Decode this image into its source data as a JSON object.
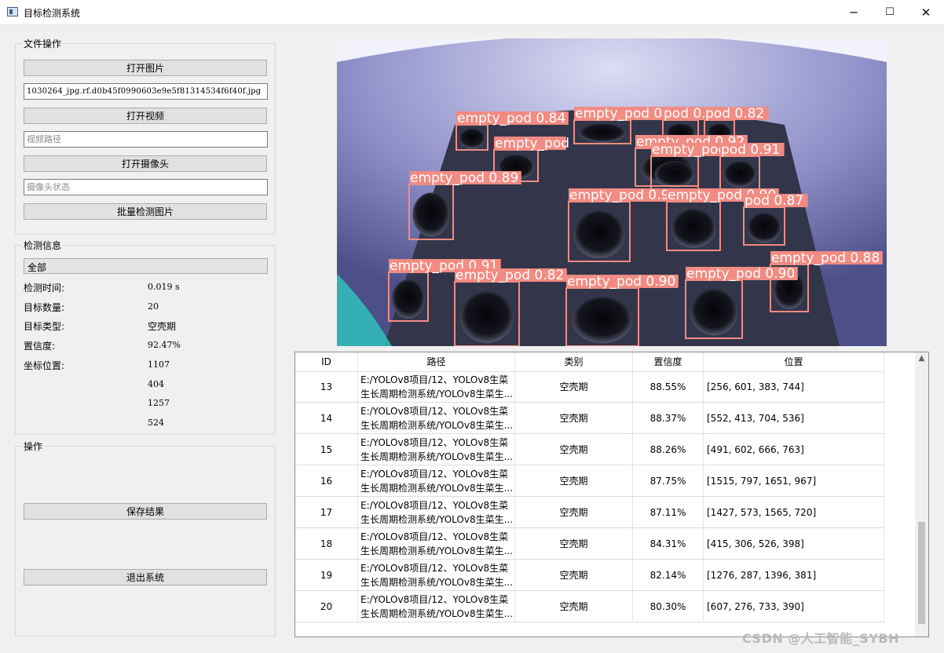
{
  "window": {
    "title": "目标检测系统",
    "minimize": "─",
    "maximize": "☐",
    "close": "✕"
  },
  "file_ops": {
    "title": "文件操作",
    "open_image": "打开图片",
    "image_path": "1030264_jpg.rf.d0b45f0990603e9e5f81314534f6f40f.jpg",
    "open_video": "打开视频",
    "video_placeholder": "视频路径",
    "open_camera": "打开摄像头",
    "camera_placeholder": "摄像头状态",
    "batch_detect": "批量检测图片"
  },
  "detect_info": {
    "title": "检测信息",
    "selected": "全部",
    "time_label": "检测时间:",
    "time_value": "0.019 s",
    "count_label": "目标数量:",
    "count_value": "20",
    "type_label": "目标类型:",
    "type_value": "空壳期",
    "conf_label": "置信度:",
    "conf_value": "92.47%",
    "pos_label": "坐标位置:",
    "pos_values": [
      "1107",
      "404",
      "1257",
      "524"
    ]
  },
  "operations": {
    "title": "操作",
    "save": "保存结果",
    "exit": "退出系统"
  },
  "detections": [
    {
      "label": "empty_pod 0.92",
      "color": "#f28b82"
    },
    {
      "label": "pod 0.90",
      "color": "#f28b82"
    },
    {
      "label": "pod 0.82",
      "color": "#f28b82"
    },
    {
      "label": "empty_pod 0.84",
      "color": "#f28b82"
    },
    {
      "label": "empty_pod 0.92",
      "color": "#f28b82"
    },
    {
      "label": "empty_pod",
      "color": "#f28b82"
    },
    {
      "label": "empty_pod 0.92",
      "color": "#f28b82"
    },
    {
      "label": "pod 0.91",
      "color": "#f28b82"
    },
    {
      "label": "empty_pod 0.89",
      "color": "#f28b82"
    },
    {
      "label": "empty_pod 0.92",
      "color": "#f28b82"
    },
    {
      "label": "empty_pod 0.90",
      "color": "#f28b82"
    },
    {
      "label": "pod 0.87",
      "color": "#f28b82"
    },
    {
      "label": "empty_pod 0.88",
      "color": "#f28b82"
    },
    {
      "label": "empty_pod 0.91",
      "color": "#f28b82"
    },
    {
      "label": "empty_pod 0.82",
      "color": "#f28b82"
    },
    {
      "label": "empty_pod 0.90",
      "color": "#f28b82"
    },
    {
      "label": "empty_pod 0.90",
      "color": "#f28b82"
    }
  ],
  "table": {
    "headers": [
      "ID",
      "路径",
      "类别",
      "置信度",
      "位置"
    ],
    "path_line1": "E:/YOLOv8项目/12、YOLOv8生菜",
    "path_line2": "生长周期检测系统/YOLOv8生菜生...",
    "rows": [
      {
        "id": "13",
        "class": "空壳期",
        "conf": "88.55%",
        "pos": "[256, 601, 383, 744]"
      },
      {
        "id": "14",
        "class": "空壳期",
        "conf": "88.37%",
        "pos": "[552, 413, 704, 536]"
      },
      {
        "id": "15",
        "class": "空壳期",
        "conf": "88.26%",
        "pos": "[491, 602, 666, 763]"
      },
      {
        "id": "16",
        "class": "空壳期",
        "conf": "87.75%",
        "pos": "[1515, 797, 1651, 967]"
      },
      {
        "id": "17",
        "class": "空壳期",
        "conf": "87.11%",
        "pos": "[1427, 573, 1565, 720]"
      },
      {
        "id": "18",
        "class": "空壳期",
        "conf": "84.31%",
        "pos": "[415, 306, 526, 398]"
      },
      {
        "id": "19",
        "class": "空壳期",
        "conf": "82.14%",
        "pos": "[1276, 287, 1396, 381]"
      },
      {
        "id": "20",
        "class": "空壳期",
        "conf": "80.30%",
        "pos": "[607, 276, 733, 390]"
      }
    ]
  },
  "watermark": "CSDN @人工智能_SYBH"
}
